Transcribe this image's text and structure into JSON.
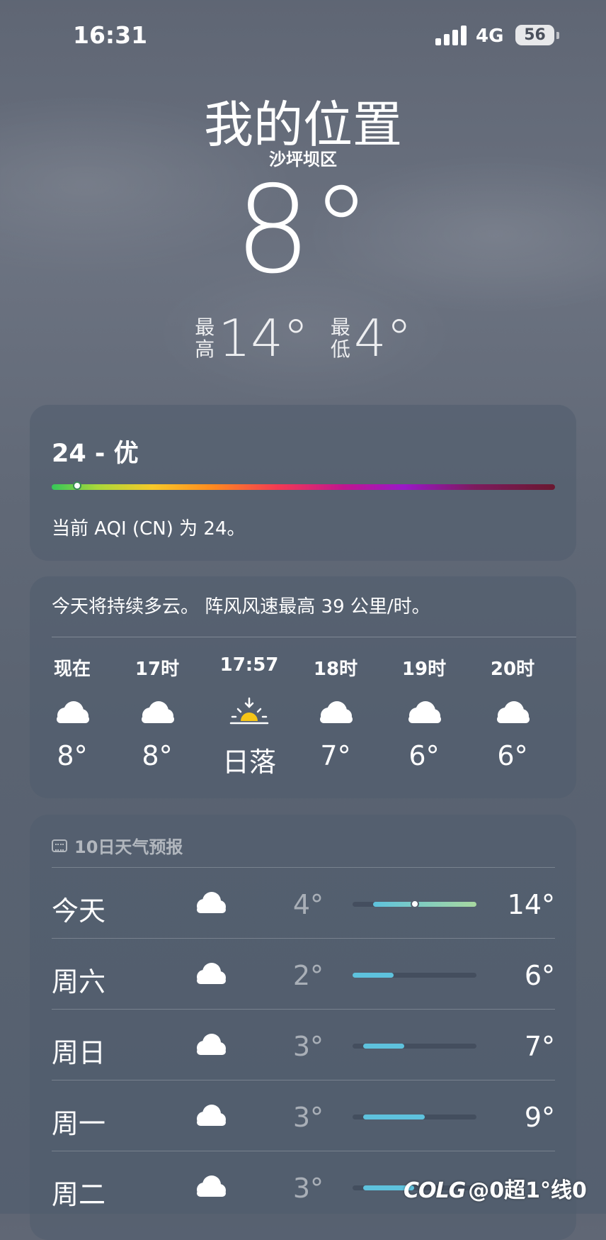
{
  "status_bar": {
    "time": "16:31",
    "network": "4G",
    "battery": "56"
  },
  "location": {
    "title": "我的位置",
    "district": "沙坪坝区",
    "temperature": "8°",
    "high_label": "最高",
    "high": "14°",
    "low_label": "最低",
    "low": "4°"
  },
  "aqi": {
    "value": "24 - 优",
    "level_fraction": 0.05,
    "description": "当前 AQI (CN) 为 24。"
  },
  "hourly": {
    "summary": "今天将持续多云。 阵风风速最高 39 公里/时。",
    "items": [
      {
        "time": "现在",
        "icon": "cloud-icon",
        "temp": "8°"
      },
      {
        "time": "17时",
        "icon": "cloud-icon",
        "temp": "8°"
      },
      {
        "time": "17:57",
        "icon": "sunset-icon",
        "temp": "日落"
      },
      {
        "time": "18时",
        "icon": "cloud-icon",
        "temp": "7°"
      },
      {
        "time": "19时",
        "icon": "cloud-icon",
        "temp": "6°"
      },
      {
        "time": "20时",
        "icon": "cloud-icon",
        "temp": "6°"
      }
    ]
  },
  "daily": {
    "header": "10日天气预报",
    "range_min": 2,
    "range_max": 14,
    "rows": [
      {
        "day": "今天",
        "icon": "cloud-icon",
        "low": "4°",
        "high": "14°",
        "low_value": 4,
        "high_value": 14,
        "current": 8
      },
      {
        "day": "周六",
        "icon": "cloud-icon",
        "low": "2°",
        "high": "6°",
        "low_value": 2,
        "high_value": 6
      },
      {
        "day": "周日",
        "icon": "cloud-icon",
        "low": "3°",
        "high": "7°",
        "low_value": 3,
        "high_value": 7
      },
      {
        "day": "周一",
        "icon": "cloud-icon",
        "low": "3°",
        "high": "9°",
        "low_value": 3,
        "high_value": 9
      },
      {
        "day": "周二",
        "icon": "cloud-icon",
        "low": "3°",
        "high": "",
        "low_value": 3,
        "high_value": 8
      }
    ]
  },
  "watermark": {
    "logo": "COLG",
    "text": "@0超1°线0"
  },
  "colors": {
    "bar_fill": "#5ec2dd",
    "today_bar_end": "#a8d8a0",
    "sun": "#f5c518"
  }
}
